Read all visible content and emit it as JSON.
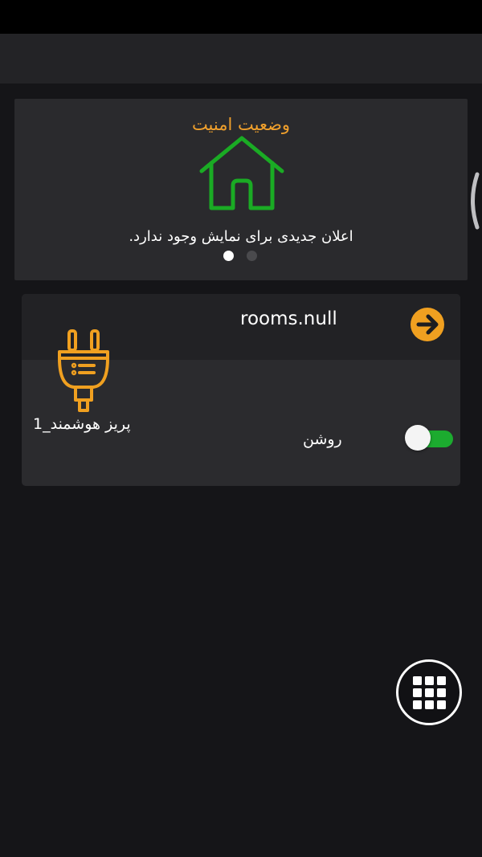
{
  "security": {
    "title": "وضعیت امنیت",
    "message": "اعلان جدیدی برای نمایش وجود ندارد.",
    "icon": "house-icon",
    "icon_color": "#1aab24",
    "pages": 2,
    "active_page": 1
  },
  "room": {
    "title": "rooms.null",
    "device": {
      "name": "پریز هوشمند_1",
      "icon": "plug-icon",
      "state_label": "روشن",
      "on": true
    },
    "open_icon": "arrow-right-icon"
  },
  "fab": {
    "icon": "grid-icon"
  },
  "colors": {
    "accent": "#f0a020",
    "toggle_on": "#1cab2f",
    "background": "#151518"
  }
}
